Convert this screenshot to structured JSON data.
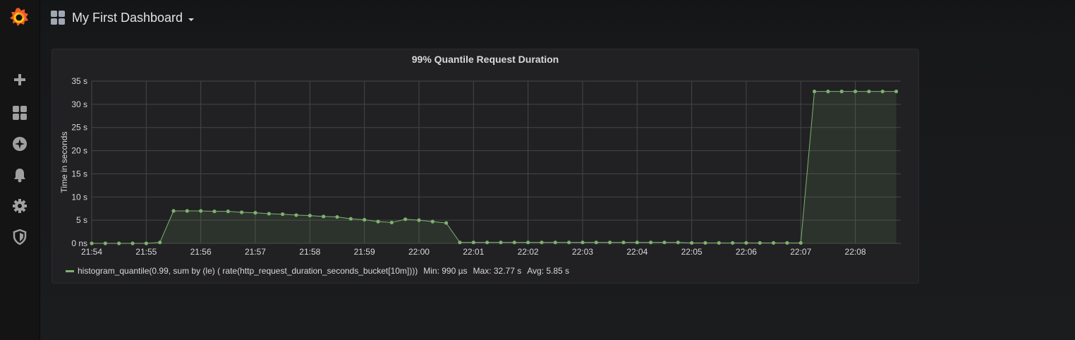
{
  "navbar": {
    "dashboard_title": "My First Dashboard"
  },
  "sidemenu": {
    "items": [
      {
        "icon": "plus-icon",
        "name": "create"
      },
      {
        "icon": "dashboards-icon",
        "name": "dashboards"
      },
      {
        "icon": "explore-icon",
        "name": "explore"
      },
      {
        "icon": "alerting-bell-icon",
        "name": "alerting"
      },
      {
        "icon": "gear-icon",
        "name": "configuration"
      },
      {
        "icon": "shield-icon",
        "name": "server-admin"
      }
    ]
  },
  "panel": {
    "title": "99% Quantile Request Duration"
  },
  "legend": {
    "series_name": "histogram_quantile(0.99, sum by (le) ( rate(http_request_duration_seconds_bucket[10m])))",
    "min": "Min: 990 µs",
    "max": "Max: 32.77 s",
    "avg": "Avg: 5.85 s"
  },
  "colors": {
    "series": "#7eb26d",
    "grid": "#464646",
    "logo_outer": "#f05a28",
    "logo_inner": "#fbca0a"
  },
  "chart_data": {
    "type": "line",
    "title": "99% Quantile Request Duration",
    "ylabel": "Time in seconds",
    "xlabel": "",
    "ylim": [
      0,
      35
    ],
    "y_ticks": [
      {
        "v": 0,
        "label": "0 ns"
      },
      {
        "v": 5,
        "label": "5 s"
      },
      {
        "v": 10,
        "label": "10 s"
      },
      {
        "v": 15,
        "label": "15 s"
      },
      {
        "v": 20,
        "label": "20 s"
      },
      {
        "v": 25,
        "label": "25 s"
      },
      {
        "v": 30,
        "label": "30 s"
      },
      {
        "v": 35,
        "label": "35 s"
      }
    ],
    "x_ticks": [
      "21:54",
      "21:55",
      "21:56",
      "21:57",
      "21:58",
      "21:59",
      "22:00",
      "22:01",
      "22:02",
      "22:03",
      "22:04",
      "22:05",
      "22:06",
      "22:07",
      "22:08"
    ],
    "x_range_minutes": [
      "21:54",
      "22:08:50"
    ],
    "grid": true,
    "fill": true,
    "series": [
      {
        "name": "histogram_quantile(0.99, sum by (le) ( rate(http_request_duration_seconds_bucket[10m])))",
        "points": [
          [
            "21:54:00",
            0.001
          ],
          [
            "21:54:15",
            0.001
          ],
          [
            "21:54:30",
            0.001
          ],
          [
            "21:54:45",
            0.001
          ],
          [
            "21:55:00",
            0.001
          ],
          [
            "21:55:15",
            0.2
          ],
          [
            "21:55:30",
            7.0
          ],
          [
            "21:55:45",
            7.0
          ],
          [
            "21:56:00",
            7.0
          ],
          [
            "21:56:15",
            6.9
          ],
          [
            "21:56:30",
            6.9
          ],
          [
            "21:56:45",
            6.7
          ],
          [
            "21:57:00",
            6.6
          ],
          [
            "21:57:15",
            6.4
          ],
          [
            "21:57:30",
            6.3
          ],
          [
            "21:57:45",
            6.1
          ],
          [
            "21:58:00",
            6.0
          ],
          [
            "21:58:15",
            5.8
          ],
          [
            "21:58:30",
            5.7
          ],
          [
            "21:58:45",
            5.3
          ],
          [
            "21:59:00",
            5.1
          ],
          [
            "21:59:15",
            4.7
          ],
          [
            "21:59:30",
            4.5
          ],
          [
            "21:59:45",
            5.2
          ],
          [
            "22:00:00",
            5.0
          ],
          [
            "22:00:15",
            4.7
          ],
          [
            "22:00:30",
            4.4
          ],
          [
            "22:00:45",
            0.2
          ],
          [
            "22:01:00",
            0.2
          ],
          [
            "22:01:15",
            0.2
          ],
          [
            "22:01:30",
            0.2
          ],
          [
            "22:01:45",
            0.2
          ],
          [
            "22:02:00",
            0.2
          ],
          [
            "22:02:15",
            0.2
          ],
          [
            "22:02:30",
            0.2
          ],
          [
            "22:02:45",
            0.2
          ],
          [
            "22:03:00",
            0.2
          ],
          [
            "22:03:15",
            0.2
          ],
          [
            "22:03:30",
            0.2
          ],
          [
            "22:03:45",
            0.2
          ],
          [
            "22:04:00",
            0.2
          ],
          [
            "22:04:15",
            0.2
          ],
          [
            "22:04:30",
            0.2
          ],
          [
            "22:04:45",
            0.2
          ],
          [
            "22:05:00",
            0.1
          ],
          [
            "22:05:15",
            0.1
          ],
          [
            "22:05:30",
            0.1
          ],
          [
            "22:05:45",
            0.1
          ],
          [
            "22:06:00",
            0.1
          ],
          [
            "22:06:15",
            0.1
          ],
          [
            "22:06:30",
            0.1
          ],
          [
            "22:06:45",
            0.1
          ],
          [
            "22:07:00",
            0.1
          ],
          [
            "22:07:15",
            32.77
          ],
          [
            "22:07:30",
            32.77
          ],
          [
            "22:07:45",
            32.77
          ],
          [
            "22:08:00",
            32.77
          ],
          [
            "22:08:15",
            32.77
          ],
          [
            "22:08:30",
            32.77
          ],
          [
            "22:08:45",
            32.77
          ]
        ]
      }
    ]
  }
}
